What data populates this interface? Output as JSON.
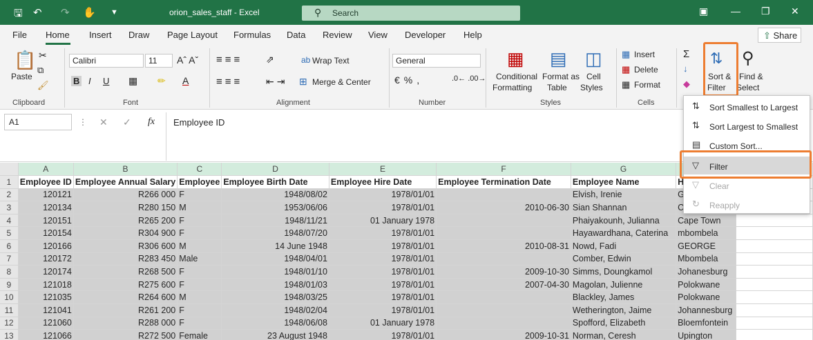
{
  "title": {
    "document": "orion_sales_staff  -  Excel",
    "search": "Search"
  },
  "menu": [
    "File",
    "Home",
    "Insert",
    "Draw",
    "Page Layout",
    "Formulas",
    "Data",
    "Review",
    "View",
    "Developer",
    "Help"
  ],
  "share": "Share",
  "ribbon": {
    "paste": "Paste",
    "font_name": "Calibri",
    "font_size": "11",
    "wrap_text": "Wrap Text",
    "merge_center": "Merge & Center",
    "number_format": "General",
    "conditional": [
      "Conditional",
      "Formatting"
    ],
    "format_as": [
      "Format as",
      "Table"
    ],
    "cell_styles": [
      "Cell",
      "Styles"
    ],
    "insert": "Insert",
    "delete": "Delete",
    "format": "Format",
    "sort_filter": [
      "Sort &",
      "Filter"
    ],
    "find_select": [
      "Find &",
      "Select"
    ],
    "groups": {
      "clipboard": "Clipboard",
      "font": "Font",
      "alignment": "Alignment",
      "number": "Number",
      "styles": "Styles",
      "cells": "Cells"
    }
  },
  "formula_bar": {
    "name_box": "A1",
    "fx": "fx",
    "content": "Employee ID"
  },
  "columns": [
    "A",
    "B",
    "C",
    "D",
    "E",
    "F",
    "G",
    "H"
  ],
  "sheet": {
    "headers": [
      "Employee ID",
      "Employee Annual Salary",
      "Employee",
      "Employee Birth Date",
      "Employee Hire Date",
      "Employee Termination Date",
      "Employee Name",
      "Home"
    ],
    "rows": [
      [
        "120121",
        "R266 000",
        "F",
        "1948/08/02",
        "1978/01/01",
        "",
        "Elvish, Irenie",
        "Gqeber"
      ],
      [
        "120134",
        "R280 150",
        "M",
        "1953/06/06",
        "1978/01/01",
        "2010-06-30",
        "Sian Shannan",
        "Cape to"
      ],
      [
        "120151",
        "R265 200",
        "F",
        "1948/11/21",
        "01 January 1978",
        "",
        "Phaiyakounh, Julianna",
        "Cape Town"
      ],
      [
        "120154",
        "R304 900",
        "F",
        "1948/07/20",
        "1978/01/01",
        "",
        "Hayawardhana, Caterina",
        "mbombela"
      ],
      [
        "120166",
        "R306 600",
        "M",
        "14 June 1948",
        "1978/01/01",
        "2010-08-31",
        "Nowd, Fadi",
        "GEORGE"
      ],
      [
        "120172",
        "R283 450",
        "Male",
        "1948/04/01",
        "1978/01/01",
        "",
        "Comber, Edwin",
        "Mbombela"
      ],
      [
        "120174",
        "R268 500",
        "F",
        "1948/01/10",
        "1978/01/01",
        "2009-10-30",
        "Simms, Doungkamol",
        "Johanesburg"
      ],
      [
        "121018",
        "R275 600",
        "F",
        "1948/01/03",
        "1978/01/01",
        "2007-04-30",
        "Magolan, Julienne",
        "Polokwane"
      ],
      [
        "121035",
        "R264 600",
        "M",
        "1948/03/25",
        "1978/01/01",
        "",
        "Blackley, James",
        "Polokwane"
      ],
      [
        "121041",
        "R261 200",
        "F",
        "1948/02/04",
        "1978/01/01",
        "",
        "Wetherington, Jaime",
        "Johannesburg"
      ],
      [
        "121060",
        "R288 000",
        "F",
        "1948/06/08",
        "01 January 1978",
        "",
        "Spofford, Elizabeth",
        "Bloemfontein"
      ],
      [
        "121066",
        "R272 500",
        "Female",
        "23 August 1948",
        "1978/01/01",
        "2009-10-31",
        "Norman, Ceresh",
        "Upington"
      ]
    ]
  },
  "dropdown": {
    "items": [
      {
        "label": "Sort Smallest to Largest",
        "icon": "sort-ascending-icon",
        "enabled": true
      },
      {
        "label": "Sort Largest to Smallest",
        "icon": "sort-descending-icon",
        "enabled": true
      },
      {
        "label": "Custom Sort...",
        "icon": "custom-sort-icon",
        "enabled": true
      },
      {
        "label": "Filter",
        "icon": "filter-icon",
        "enabled": true
      },
      {
        "label": "Clear",
        "icon": "clear-filter-icon",
        "enabled": false
      },
      {
        "label": "Reapply",
        "icon": "reapply-icon",
        "enabled": false
      }
    ]
  },
  "colors": {
    "brand": "#217346",
    "highlight": "#ed7d31",
    "selection": "#d1d1d1"
  }
}
